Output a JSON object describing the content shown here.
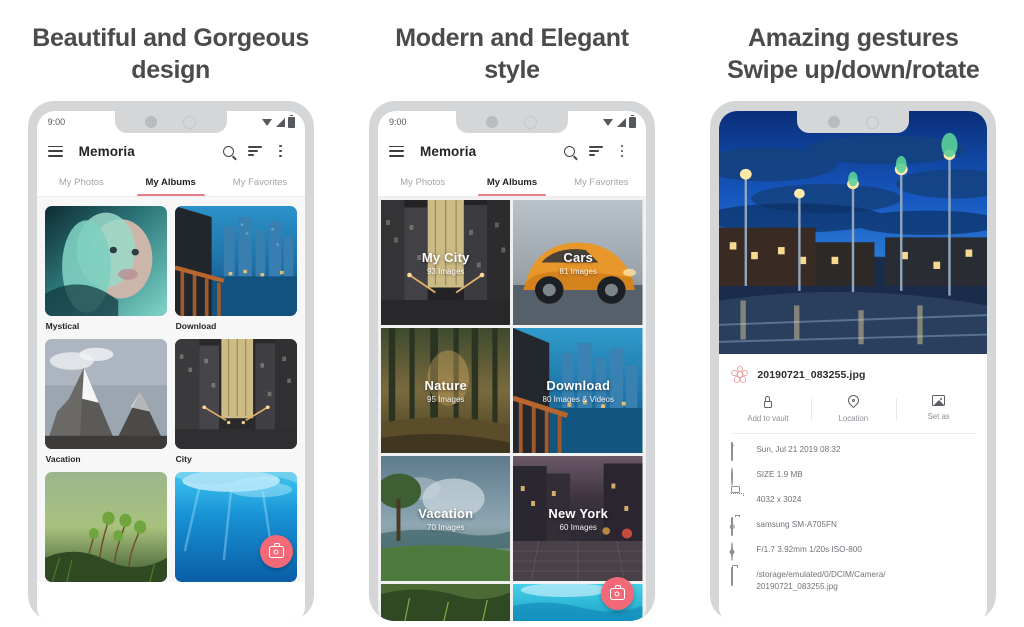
{
  "panels": [
    {
      "heading_line1": "Beautiful and Gorgeous",
      "heading_line2": "design",
      "status_time": "9:00",
      "appbar": {
        "title": "Memoria",
        "menu_icon": "hamburger-icon",
        "search_icon": "search-icon",
        "sort_icon": "sort-icon",
        "more_icon": "more-vertical-icon"
      },
      "tabs": [
        {
          "label": "My Photos",
          "active": false
        },
        {
          "label": "My Albums",
          "active": true
        },
        {
          "label": "My Favorites",
          "active": false
        }
      ],
      "albums": [
        {
          "label": "Mystical"
        },
        {
          "label": "Download"
        },
        {
          "label": "Vacation"
        },
        {
          "label": "City"
        },
        {
          "label": ""
        },
        {
          "label": ""
        }
      ],
      "fab_icon": "camera-icon"
    },
    {
      "heading_line1": "Modern and Elegant",
      "heading_line2": "style",
      "status_time": "9:00",
      "appbar": {
        "title": "Memoria",
        "menu_icon": "hamburger-icon",
        "search_icon": "search-icon",
        "sort_icon": "sort-icon",
        "more_icon": "more-vertical-icon"
      },
      "tabs": [
        {
          "label": "My Photos",
          "active": false
        },
        {
          "label": "My Albums",
          "active": true
        },
        {
          "label": "My Favorites",
          "active": false
        }
      ],
      "albums": [
        {
          "title": "My City",
          "subtitle": "93 Images"
        },
        {
          "title": "Cars",
          "subtitle": "81 Images"
        },
        {
          "title": "Nature",
          "subtitle": "95 Images"
        },
        {
          "title": "Download",
          "subtitle": "80 Images & Videos"
        },
        {
          "title": "Vacation",
          "subtitle": "70 Images"
        },
        {
          "title": "New York",
          "subtitle": "60 Images"
        },
        {
          "title": "",
          "subtitle": ""
        },
        {
          "title": "",
          "subtitle": ""
        }
      ],
      "fab_icon": "camera-icon"
    },
    {
      "heading_line1": "Amazing gestures",
      "heading_line2": "Swipe up/down/rotate",
      "detail": {
        "filename": "20190721_083255.jpg",
        "file_icon": "flower-icon",
        "actions": [
          {
            "label": "Add to vault",
            "icon": "lock-icon"
          },
          {
            "label": "Location",
            "icon": "location-pin-icon"
          },
          {
            "label": "Set as",
            "icon": "image-icon"
          }
        ],
        "metadata": [
          {
            "icon": "calendar-icon",
            "text": "Sun, Jul 21 2019 08:32"
          },
          {
            "icon": "size-circle-icon",
            "text": "SIZE 1.9 MB"
          },
          {
            "icon": "resolution-icon",
            "text": "4032 x 3024"
          },
          {
            "icon": "camera-icon",
            "text": "samsung SM-A705FN"
          },
          {
            "icon": "aperture-icon",
            "text": "F/1.7 3.92mm 1/20s ISO-800"
          },
          {
            "icon": "folder-icon",
            "text": "/storage/emulated/0/DCIM/Camera/ 20190721_083255.jpg"
          }
        ]
      }
    }
  ],
  "colors": {
    "accent_pink": "#f2697a",
    "tab_underline": "#e77f8e",
    "phone_frame": "#d4d6d8",
    "heading_text": "#4b4b4b"
  }
}
